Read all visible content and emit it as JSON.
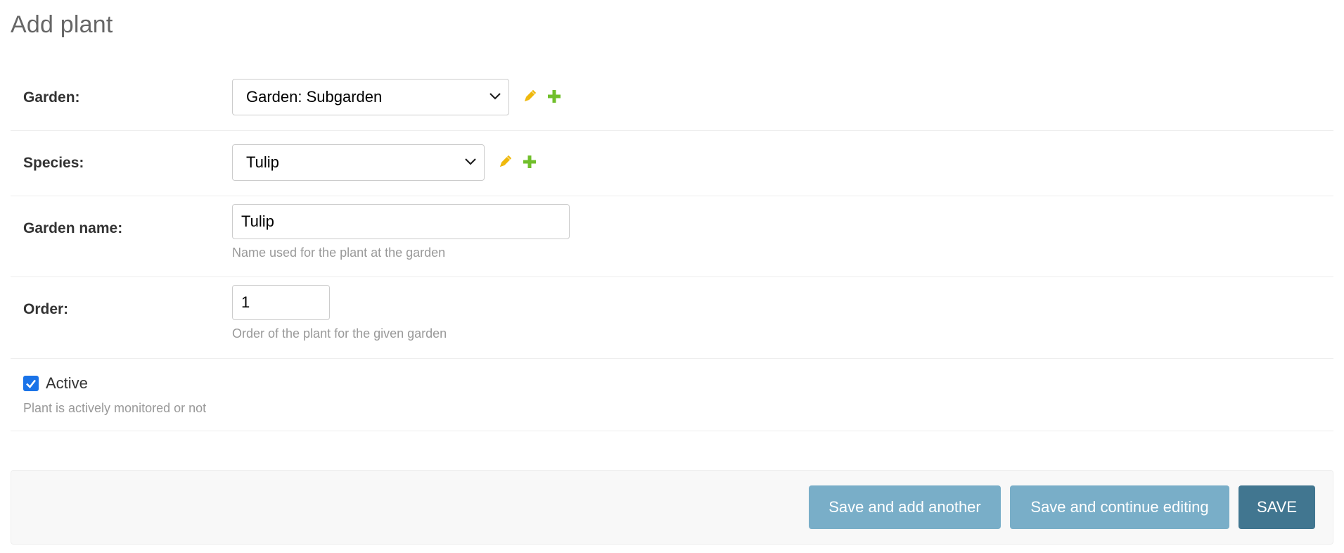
{
  "page": {
    "title": "Add plant"
  },
  "fields": {
    "garden": {
      "label": "Garden:",
      "selected": "Garden: Subgarden"
    },
    "species": {
      "label": "Species:",
      "selected": "Tulip"
    },
    "garden_name": {
      "label": "Garden name:",
      "value": "Tulip",
      "help": "Name used for the plant at the garden"
    },
    "order": {
      "label": "Order:",
      "value": "1",
      "help": "Order of the plant for the given garden"
    },
    "active": {
      "label": "Active",
      "checked": true,
      "help": "Plant is actively monitored or not"
    }
  },
  "icons": {
    "edit": "pencil-icon",
    "add": "plus-icon",
    "dropdown": "chevron-down-icon",
    "checkmark": "checkmark-icon"
  },
  "actions": {
    "save_add_another": "Save and add another",
    "save_continue": "Save and continue editing",
    "save": "SAVE"
  },
  "colors": {
    "edit_icon": "#efb80b",
    "add_icon": "#70bf2b",
    "button_light": "#79aec8",
    "button_dark": "#417690",
    "checkbox": "#1a73e8"
  }
}
